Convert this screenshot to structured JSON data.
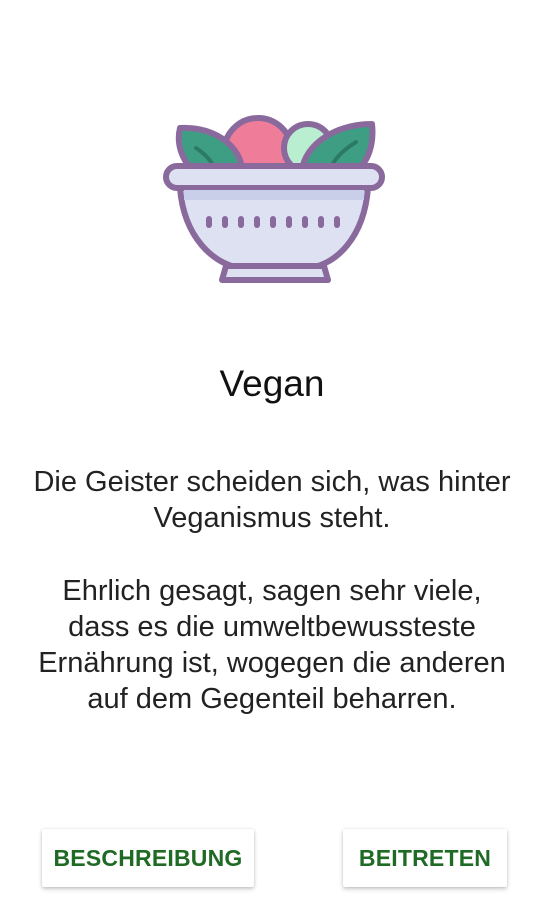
{
  "card": {
    "icon": "salad-bowl-icon",
    "title": "Vegan",
    "paragraph1": "Die Geister scheiden sich, was hinter Veganismus steht.",
    "paragraph2": "Ehrlich gesagt, sagen sehr viele, dass es die umweltbewussteste Ernährung ist, wogegen die anderen auf dem Gegenteil beharren."
  },
  "buttons": {
    "description_label": "BESCHREIBUNG",
    "join_label": "BEITRETEN"
  },
  "colors": {
    "button_text": "#1f6a24",
    "outline": "#8a6a9c",
    "bowl_fill": "#dde1f2",
    "leaf_green": "#3e9e84",
    "tomato_pink": "#ef7d9a",
    "mint": "#b9eed0"
  }
}
